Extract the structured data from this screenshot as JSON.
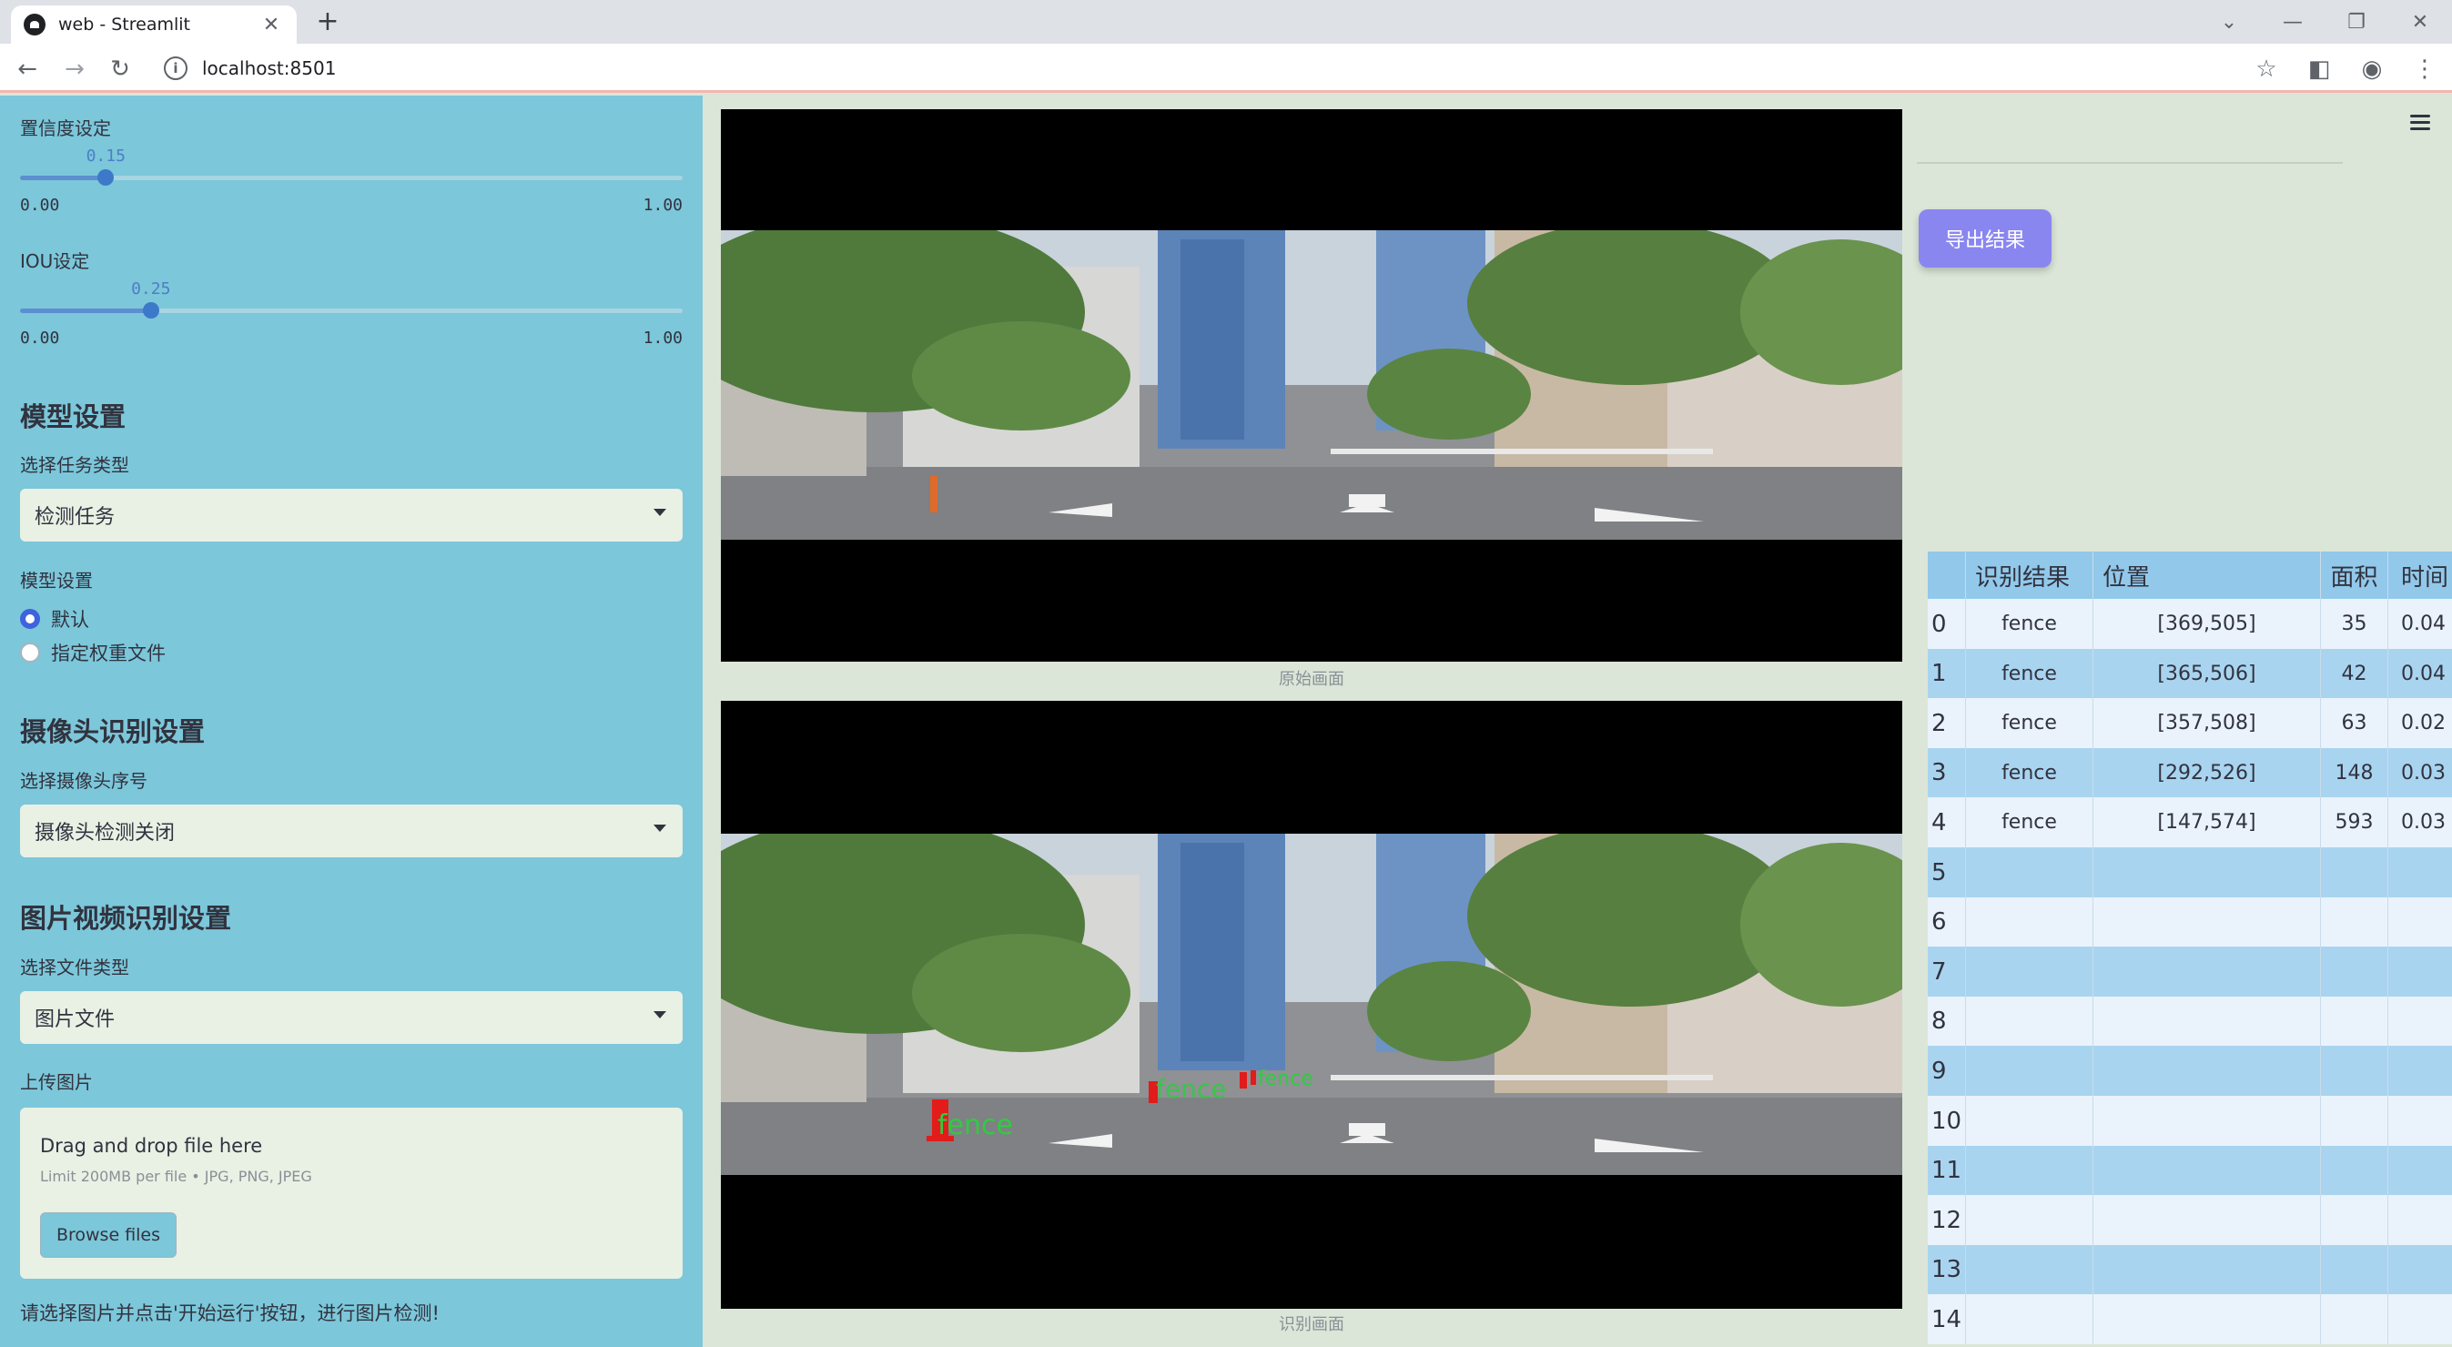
{
  "browser": {
    "tab_title": "web - Streamlit",
    "url": "localhost:8501"
  },
  "sidebar": {
    "confidence": {
      "label": "置信度设定",
      "value": "0.15",
      "value_num": 0.15,
      "min": "0.00",
      "max": "1.00"
    },
    "iou": {
      "label": "IOU设定",
      "value": "0.25",
      "value_num": 0.25,
      "min": "0.00",
      "max": "1.00"
    },
    "model_section": {
      "title": "模型设置",
      "task_label": "选择任务类型",
      "task_value": "检测任务",
      "model_label": "模型设置",
      "options": [
        "默认",
        "指定权重文件"
      ],
      "selected": 0
    },
    "camera_section": {
      "title": "摄像头识别设置",
      "camera_label": "选择摄像头序号",
      "camera_value": "摄像头检测关闭"
    },
    "media_section": {
      "title": "图片视频识别设置",
      "file_type_label": "选择文件类型",
      "file_type_value": "图片文件",
      "upload_label": "上传图片",
      "drop_title": "Drag and drop file here",
      "drop_limit": "Limit 200MB per file • JPG, PNG, JPEG",
      "browse_label": "Browse files"
    },
    "hint": "请选择图片并点击'开始运行'按钮，进行图片检测!"
  },
  "main": {
    "original_caption": "原始画面",
    "detected_caption": "识别画面",
    "detection_label": "fence",
    "export_label": "导出结果"
  },
  "table": {
    "headers": [
      "",
      "识别结果",
      "位置",
      "面积",
      "时间"
    ],
    "rows": [
      [
        "0",
        "fence",
        "[369,505]",
        "35",
        "0.04"
      ],
      [
        "1",
        "fence",
        "[365,506]",
        "42",
        "0.04"
      ],
      [
        "2",
        "fence",
        "[357,508]",
        "63",
        "0.02"
      ],
      [
        "3",
        "fence",
        "[292,526]",
        "148",
        "0.03"
      ],
      [
        "4",
        "fence",
        "[147,574]",
        "593",
        "0.03"
      ],
      [
        "5",
        "",
        "",
        "",
        ""
      ],
      [
        "6",
        "",
        "",
        "",
        ""
      ],
      [
        "7",
        "",
        "",
        "",
        ""
      ],
      [
        "8",
        "",
        "",
        "",
        ""
      ],
      [
        "9",
        "",
        "",
        "",
        ""
      ],
      [
        "10",
        "",
        "",
        "",
        ""
      ],
      [
        "11",
        "",
        "",
        "",
        ""
      ],
      [
        "12",
        "",
        "",
        "",
        ""
      ],
      [
        "13",
        "",
        "",
        "",
        ""
      ],
      [
        "14",
        "",
        "",
        "",
        ""
      ]
    ]
  },
  "colors": {
    "sidebar_bg": "#7cc7da",
    "main_bg": "#dbe6d8",
    "accent": "#8a86f0",
    "detection": "#2ecc40"
  }
}
